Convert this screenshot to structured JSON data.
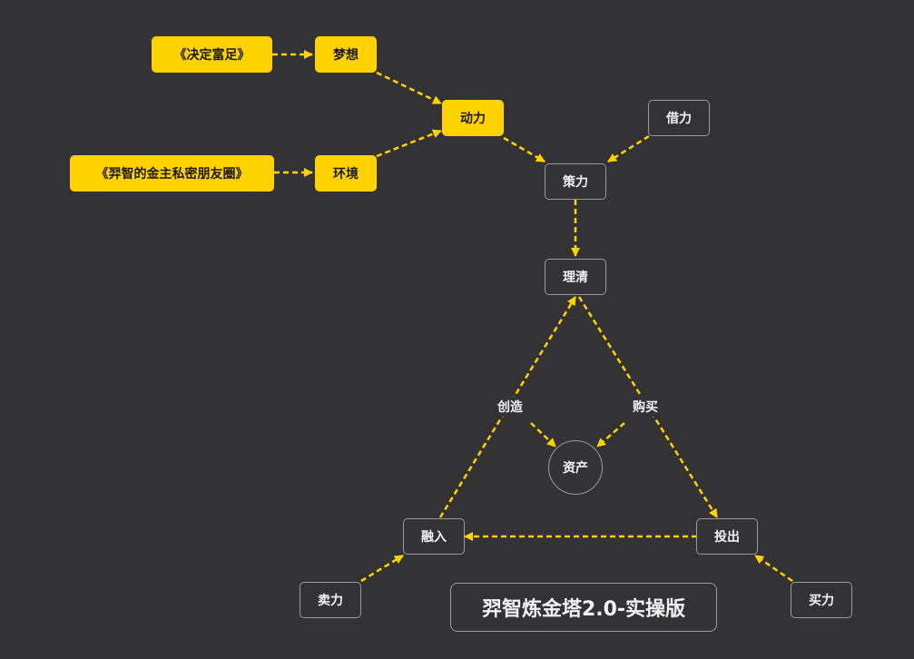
{
  "nodes": {
    "book_decide_rich": "《决定富足》",
    "dream": "梦想",
    "motivation": "动力",
    "book_circle": "《羿智的金主私密朋友圈》",
    "environment": "环境",
    "borrow_power": "借力",
    "strategy": "策力",
    "clarify": "理清",
    "create": "创造",
    "buy": "购买",
    "assets": "资产",
    "integrate": "融入",
    "invest": "投出",
    "sell_power": "卖力",
    "buy_power": "买力"
  },
  "title": "羿智炼金塔2.0-实操版",
  "colors": {
    "background": "#333235",
    "accent": "#FFD200",
    "border": "#9a9a9a",
    "text": "#f2f2f2"
  }
}
